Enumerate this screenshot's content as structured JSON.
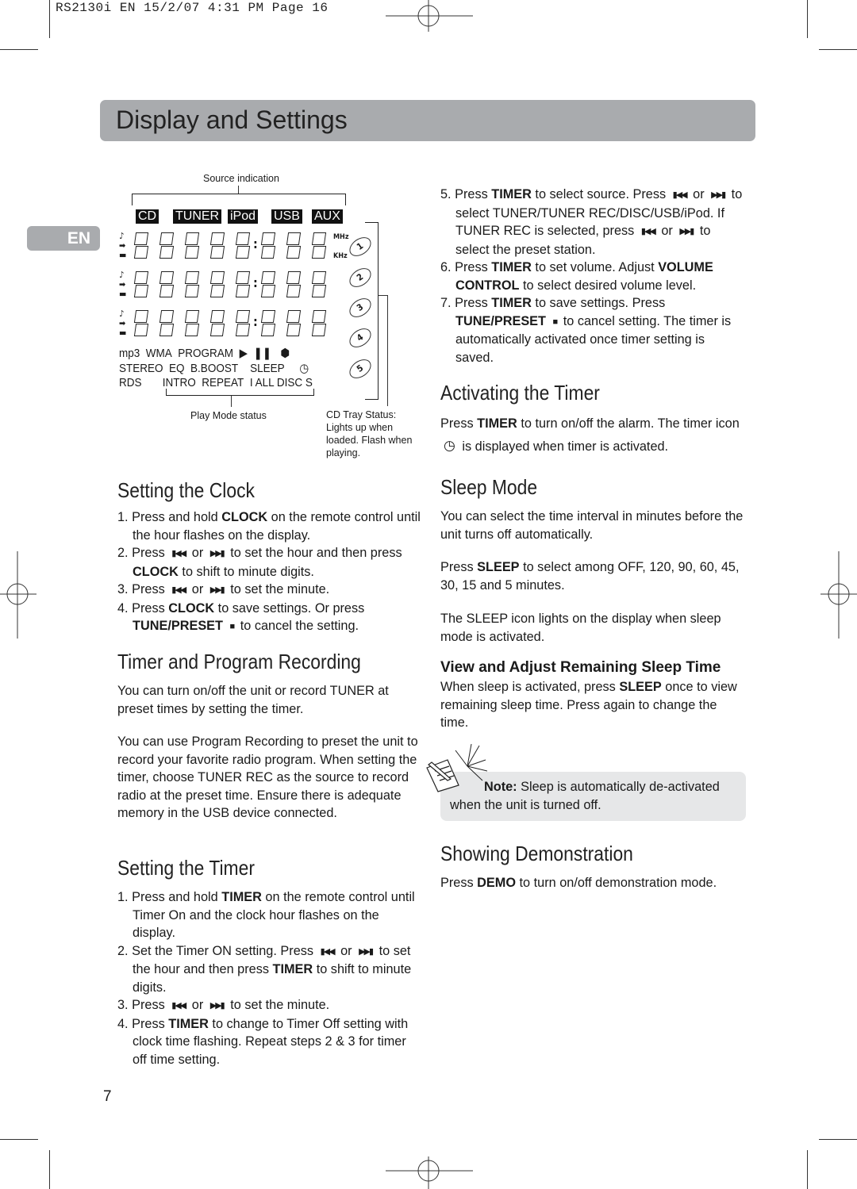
{
  "print_header": "RS2130i EN  15/2/07  4:31 PM  Page 16",
  "title": "Display and Settings",
  "lang_tab": "EN",
  "diagram": {
    "source_label": "Source indication",
    "sources": [
      "CD",
      "TUNER",
      "iPod",
      "USB",
      "AUX"
    ],
    "units": [
      "MHz",
      "KHz"
    ],
    "indicators_row1": [
      "mp3",
      "WMA",
      "PROGRAM",
      "▶",
      "❚❚"
    ],
    "indicators_row2": [
      "STEREO",
      "EQ",
      "B.BOOST",
      "SLEEP"
    ],
    "indicators_row3": [
      "RDS",
      "INTRO",
      "REPEAT",
      "I ALL",
      "DISC S"
    ],
    "trays": [
      "1",
      "2",
      "3",
      "4",
      "5"
    ],
    "play_mode_label": "Play Mode status",
    "tray_label": [
      "CD Tray Status:",
      "Lights up when",
      "loaded. Flash when",
      "playing."
    ]
  },
  "left": {
    "clock_heading": "Setting the Clock",
    "clock_steps": [
      [
        {
          "t": "1. Press and hold "
        },
        {
          "b": "CLOCK"
        },
        {
          "t": " on the remote control until the hour flashes on the display."
        }
      ],
      [
        {
          "t": "2. Press "
        },
        {
          "i": "prev"
        },
        {
          "t": " or "
        },
        {
          "i": "next"
        },
        {
          "t": " to set the hour and then press "
        },
        {
          "b": "CLOCK"
        },
        {
          "t": " to shift to minute digits."
        }
      ],
      [
        {
          "t": "3. Press "
        },
        {
          "i": "prev"
        },
        {
          "t": " or "
        },
        {
          "i": "next"
        },
        {
          "t": " to set the minute."
        }
      ],
      [
        {
          "t": "4. Press "
        },
        {
          "b": "CLOCK"
        },
        {
          "t": "  to save settings. Or press "
        },
        {
          "b": "TUNE/PRESET"
        },
        {
          "t": " "
        },
        {
          "i": "stop"
        },
        {
          "t": " to cancel the setting."
        }
      ]
    ],
    "timer_prog_heading": "Timer and Program Recording",
    "timer_prog_p1": "You can turn on/off the unit or record TUNER at preset times by setting the timer.",
    "timer_prog_p2": "You can use Program Recording to preset the unit to record your favorite radio program. When setting the timer, choose TUNER REC as the source to record radio at the preset time. Ensure there is adequate memory in the USB device connected.",
    "set_timer_heading": "Setting the Timer",
    "set_timer_steps": [
      [
        {
          "t": "1. Press and hold "
        },
        {
          "b": "TIMER"
        },
        {
          "t": " on the remote control until Timer On and the clock hour flashes on the display."
        }
      ],
      [
        {
          "t": "2. Set the Timer ON setting. Press "
        },
        {
          "i": "prev"
        },
        {
          "t": " or "
        },
        {
          "i": "next"
        },
        {
          "t": " to set the hour and then press "
        },
        {
          "b": "TIMER"
        },
        {
          "t": " to shift to minute digits."
        }
      ],
      [
        {
          "t": "3. Press "
        },
        {
          "i": "prev"
        },
        {
          "t": " or "
        },
        {
          "i": "next"
        },
        {
          "t": " to set the minute."
        }
      ],
      [
        {
          "t": "4. Press "
        },
        {
          "b": "TIMER"
        },
        {
          "t": " to change to Timer Off setting with clock time flashing. Repeat steps 2 & 3 for timer off time setting."
        }
      ]
    ]
  },
  "right": {
    "timer_steps": [
      [
        {
          "t": "5. Press "
        },
        {
          "b": "TIMER"
        },
        {
          "t": " to select source. Press "
        },
        {
          "i": "prev"
        },
        {
          "t": " or "
        },
        {
          "i": "next"
        },
        {
          "t": " to select TUNER/TUNER REC/DISC/USB/iPod. If TUNER REC is selected, press "
        },
        {
          "i": "prev"
        },
        {
          "t": " or "
        },
        {
          "i": "next"
        },
        {
          "t": " to select the preset station."
        }
      ],
      [
        {
          "t": "6. Press "
        },
        {
          "b": "TIMER"
        },
        {
          "t": " to set volume.  Adjust "
        },
        {
          "b": "VOLUME CONTROL"
        },
        {
          "t": " to select desired volume level."
        }
      ],
      [
        {
          "t": "7. Press "
        },
        {
          "b": "TIMER"
        },
        {
          "t": " to save settings. Press "
        },
        {
          "b": "TUNE/PRESET"
        },
        {
          "t": " "
        },
        {
          "i": "stop"
        },
        {
          "t": " to cancel setting. The timer is automatically activated once timer setting is saved."
        }
      ]
    ],
    "activate_heading": "Activating the Timer",
    "activate_p": [
      {
        "t": "Press "
      },
      {
        "b": "TIMER"
      },
      {
        "t": " to turn on/off the alarm. The timer icon "
      },
      {
        "i": "clock"
      },
      {
        "t": " is displayed when timer is activated."
      }
    ],
    "sleep_heading": "Sleep Mode",
    "sleep_p1": "You can select the time interval in minutes before the unit turns off automatically.",
    "sleep_p2": [
      {
        "t": "Press "
      },
      {
        "b": "SLEEP"
      },
      {
        "t": " to select among OFF, 120, 90, 60, 45, 30, 15 and  5 minutes."
      }
    ],
    "sleep_p3": "The SLEEP icon lights on the display when sleep mode is activated.",
    "remaining_heading": "View and Adjust Remaining Sleep Time",
    "remaining_p": [
      {
        "t": "When sleep is activated, press "
      },
      {
        "b": "SLEEP"
      },
      {
        "t": " once to view remaining sleep time. Press again to change the time."
      }
    ],
    "note_label": "Note:",
    "note_text": " Sleep is automatically de-activated when the unit is turned off.",
    "demo_heading": "Showing Demonstration",
    "demo_p": [
      {
        "t": "Press "
      },
      {
        "b": "DEMO"
      },
      {
        "t": " to turn on/off demonstration mode."
      }
    ]
  },
  "page_number": "7"
}
